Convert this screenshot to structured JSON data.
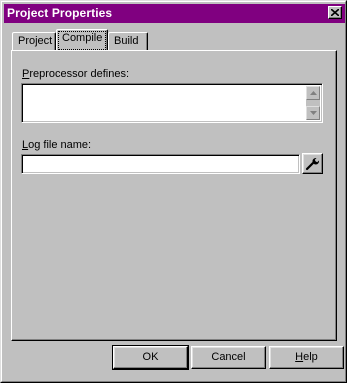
{
  "window": {
    "title": "Project Properties"
  },
  "tabs": [
    {
      "label": "Project"
    },
    {
      "label": "Compile"
    },
    {
      "label": "Build"
    }
  ],
  "compile": {
    "preprocessor_label_mnemonic": "P",
    "preprocessor_label_rest": "reprocessor defines:",
    "preprocessor_value": "",
    "logfile_label_mnemonic": "L",
    "logfile_label_rest": "og file name:",
    "logfile_value": ""
  },
  "buttons": {
    "ok": "OK",
    "cancel": "Cancel",
    "help_mnemonic": "H",
    "help_rest": "elp"
  },
  "icons": {
    "close": "close-icon",
    "scroll_up": "arrow-up-icon",
    "scroll_down": "arrow-down-icon",
    "browse": "wrench-icon"
  }
}
